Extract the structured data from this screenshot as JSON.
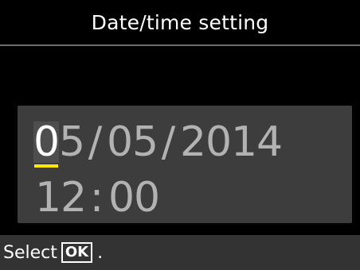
{
  "title": "Date/time setting",
  "date": {
    "month": [
      "0",
      "5"
    ],
    "separator1": "/",
    "day": [
      "0",
      "5"
    ],
    "separator2": "/",
    "year": [
      "2",
      "0",
      "1",
      "4"
    ]
  },
  "time": {
    "hour": [
      "1",
      "2"
    ],
    "separator": ":",
    "minute": [
      "0",
      "0"
    ]
  },
  "footer": {
    "select_label": "Select",
    "ok_key": "OK",
    "period": "."
  },
  "colors": {
    "background": "#000000",
    "panel": "#3d3d3d",
    "cursor_underline": "#ffe800",
    "inactive_digit": "#b2b2b2"
  }
}
